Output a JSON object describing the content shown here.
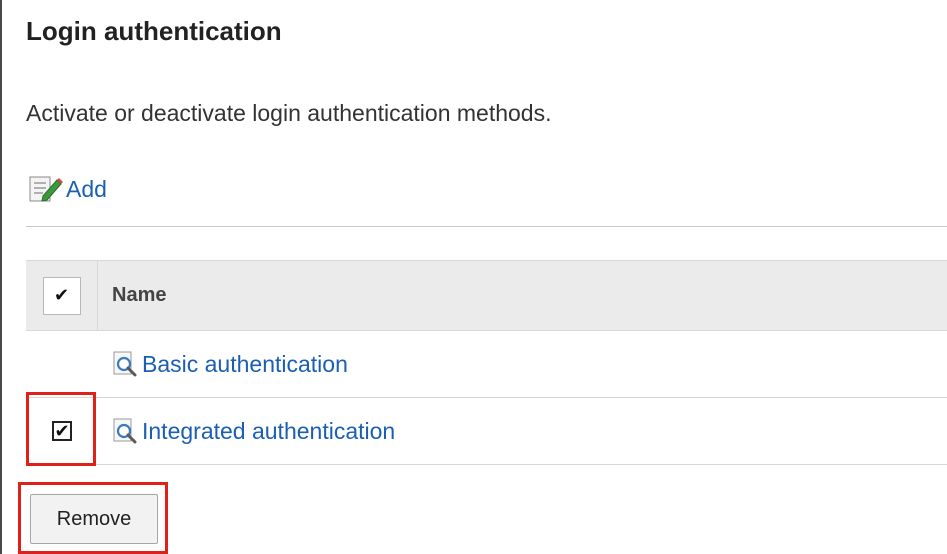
{
  "page": {
    "title": "Login authentication",
    "description": "Activate or deactivate login authentication methods."
  },
  "actions": {
    "add_label": "Add",
    "add_icon": "edit-note-icon",
    "remove_label": "Remove"
  },
  "table": {
    "select_all_glyph": "✔",
    "columns": [
      {
        "label": "Name"
      }
    ],
    "rows": [
      {
        "name": "Basic authentication",
        "checked": false,
        "icon": "magnifier-icon"
      },
      {
        "name": "Integrated authentication",
        "checked": true,
        "icon": "magnifier-icon"
      }
    ]
  },
  "colors": {
    "link": "#1a5fb4",
    "header_bg": "#ebebeb",
    "highlight": "#e0201b"
  }
}
